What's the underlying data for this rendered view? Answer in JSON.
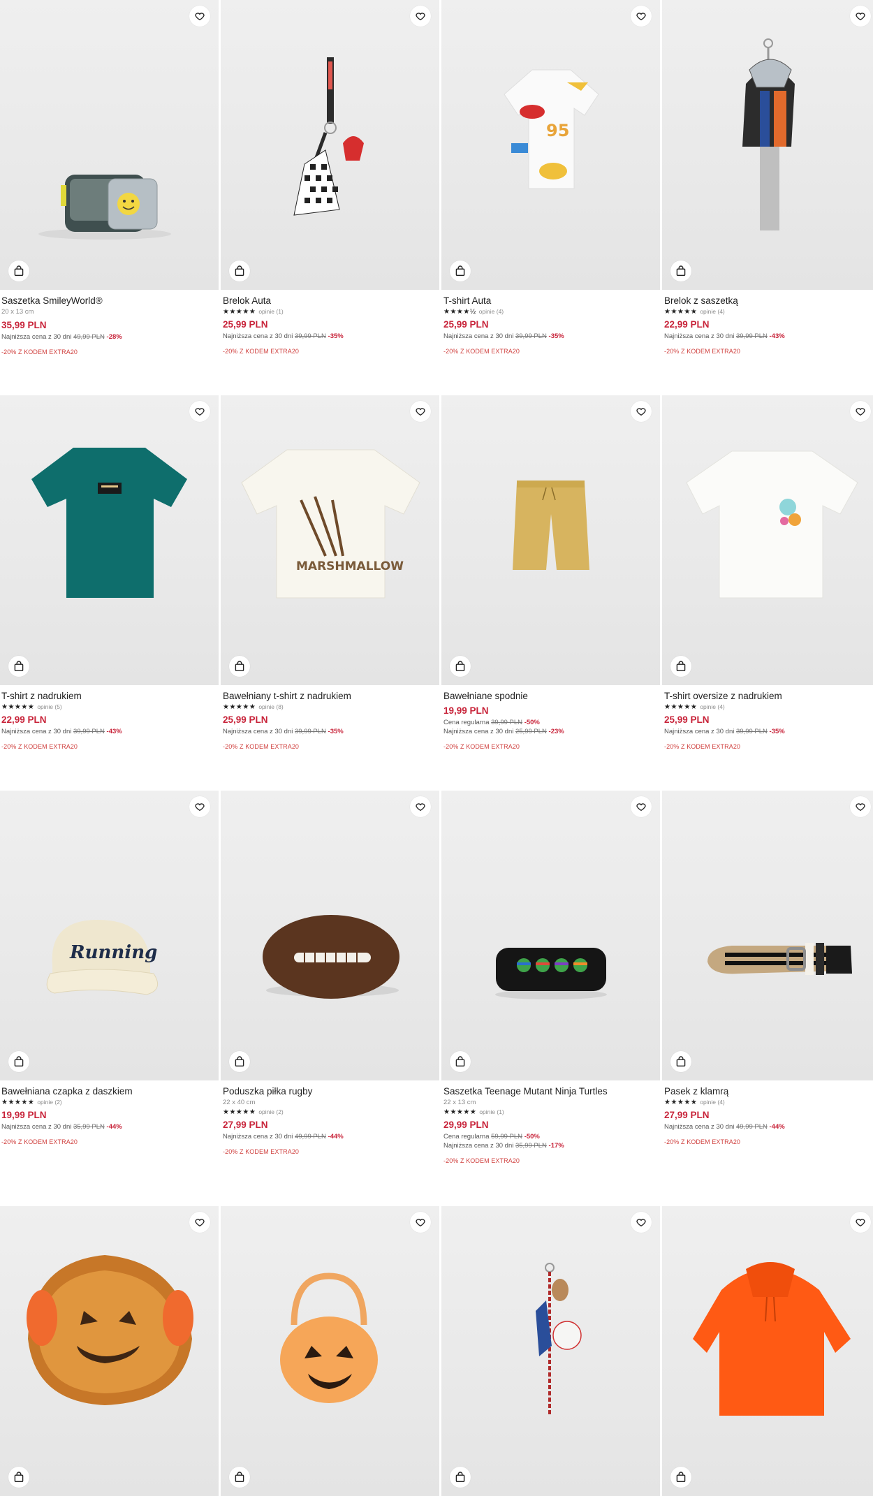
{
  "colors": {
    "price": "#c8243a",
    "promo": "#d0413f",
    "photo_bg": "#ececec"
  },
  "icons": {
    "wishlist": "heart-icon",
    "cart": "shopping-bag-icon",
    "rating": "star-icon"
  },
  "products": [
    {
      "name": "Saszetka SmileyWorld®",
      "dims": "20 x 13 cm",
      "price": "35,99 PLN",
      "lowest_label": "Najniższa cena z 30 dni",
      "lowest_old": "49,99 PLN",
      "lowest_disc": "-28%",
      "promo": "-20% Z KODEM EXTRA20"
    },
    {
      "name": "Brelok Auta",
      "stars": "★★★★★",
      "reviews": "opinie (1)",
      "price": "25,99 PLN",
      "lowest_label": "Najniższa cena z 30 dni",
      "lowest_old": "39,99 PLN",
      "lowest_disc": "-35%",
      "promo": "-20% Z KODEM EXTRA20"
    },
    {
      "name": "T-shirt Auta",
      "stars": "★★★★½",
      "reviews": "opinie (4)",
      "price": "25,99 PLN",
      "lowest_label": "Najniższa cena z 30 dni",
      "lowest_old": "39,99 PLN",
      "lowest_disc": "-35%",
      "promo": "-20% Z KODEM EXTRA20"
    },
    {
      "name": "Brelok z saszetką",
      "stars": "★★★★★",
      "reviews": "opinie (4)",
      "price": "22,99 PLN",
      "lowest_label": "Najniższa cena z 30 dni",
      "lowest_old": "39,99 PLN",
      "lowest_disc": "-43%",
      "promo": "-20% Z KODEM EXTRA20"
    },
    {
      "name": "T-shirt z nadrukiem",
      "stars": "★★★★★",
      "reviews": "opinie (5)",
      "price": "22,99 PLN",
      "lowest_label": "Najniższa cena z 30 dni",
      "lowest_old": "39,99 PLN",
      "lowest_disc": "-43%",
      "promo": "-20% Z KODEM EXTRA20"
    },
    {
      "name": "Bawełniany t-shirt z nadrukiem",
      "stars": "★★★★★",
      "reviews": "opinie (8)",
      "price": "25,99 PLN",
      "lowest_label": "Najniższa cena z 30 dni",
      "lowest_old": "39,99 PLN",
      "lowest_disc": "-35%",
      "promo": "-20% Z KODEM EXTRA20"
    },
    {
      "name": "Bawełniane spodnie",
      "price": "19,99 PLN",
      "regular_label": "Cena regularna",
      "regular_old": "39,99 PLN",
      "regular_disc": "-50%",
      "lowest_label": "Najniższa cena z 30 dni",
      "lowest_old": "25,99 PLN",
      "lowest_disc": "-23%",
      "promo": "-20% Z KODEM EXTRA20"
    },
    {
      "name": "T-shirt oversize z nadrukiem",
      "stars": "★★★★★",
      "reviews": "opinie (4)",
      "price": "25,99 PLN",
      "lowest_label": "Najniższa cena z 30 dni",
      "lowest_old": "39,99 PLN",
      "lowest_disc": "-35%",
      "promo": "-20% Z KODEM EXTRA20"
    },
    {
      "name": "Bawełniana czapka z daszkiem",
      "stars": "★★★★★",
      "reviews": "opinie (2)",
      "price": "19,99 PLN",
      "lowest_label": "Najniższa cena z 30 dni",
      "lowest_old": "35,99 PLN",
      "lowest_disc": "-44%",
      "promo": "-20% Z KODEM EXTRA20"
    },
    {
      "name": "Poduszka piłka rugby",
      "dims": "22 x 40 cm",
      "stars": "★★★★★",
      "reviews": "opinie (2)",
      "price": "27,99 PLN",
      "lowest_label": "Najniższa cena z 30 dni",
      "lowest_old": "49,99 PLN",
      "lowest_disc": "-44%",
      "promo": "-20% Z KODEM EXTRA20"
    },
    {
      "name": "Saszetka Teenage Mutant Ninja Turtles",
      "dims": "22 x 13 cm",
      "stars": "★★★★★",
      "reviews": "opinie (1)",
      "price": "29,99 PLN",
      "regular_label": "Cena regularna",
      "regular_old": "59,99 PLN",
      "regular_disc": "-50%",
      "lowest_label": "Najniższa cena z 30 dni",
      "lowest_old": "35,99 PLN",
      "lowest_disc": "-17%",
      "promo": "-20% Z KODEM EXTRA20"
    },
    {
      "name": "Pasek z klamrą",
      "stars": "★★★★★",
      "reviews": "opinie (4)",
      "price": "27,99 PLN",
      "lowest_label": "Najniższa cena z 30 dni",
      "lowest_old": "49,99 PLN",
      "lowest_disc": "-44%",
      "promo": "-20% Z KODEM EXTRA20"
    },
    {
      "name": ""
    },
    {
      "name": ""
    },
    {
      "name": ""
    },
    {
      "name": ""
    }
  ]
}
